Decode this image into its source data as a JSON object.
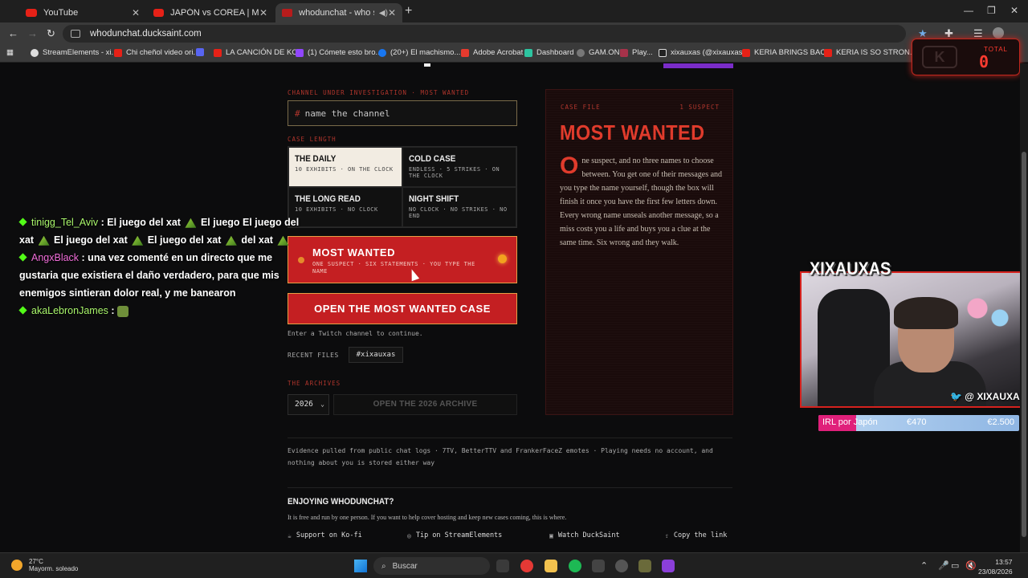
{
  "browser": {
    "tabs": [
      {
        "title": "YouTube"
      },
      {
        "title": "JAPÓN vs COREA | Mikkita y Bl..."
      },
      {
        "title": "whodunchat - who said it i"
      }
    ],
    "url": "whodunchat.ducksaint.com",
    "bookmarks": [
      "StreamElements - xi...",
      "Chi cheñol video ori...",
      "",
      "LA CANCIÓN DE KO...",
      "(1) Cómete esto bro...",
      "(20+) El machismo...",
      "Adobe Acrobat",
      "Dashboard",
      "GAM.ONL",
      "Play...",
      "xixauxas (@xixauxas...",
      "KERIA BRINGS BAC...",
      "KERIA IS SO STRON..."
    ]
  },
  "overlay_total": {
    "label": "TOTAL",
    "value": "0"
  },
  "form": {
    "channel_label": "CHANNEL UNDER INVESTIGATION · MOST WANTED",
    "channel_hash": "#",
    "channel_placeholder": "name the channel",
    "case_length_label": "CASE LENGTH",
    "modes": [
      {
        "name": "THE DAILY",
        "desc": "10 EXHIBITS · ON THE CLOCK",
        "selected": true
      },
      {
        "name": "COLD CASE",
        "desc": "ENDLESS · 5 STRIKES · ON THE CLOCK",
        "selected": false
      },
      {
        "name": "THE LONG READ",
        "desc": "10 EXHIBITS · NO CLOCK",
        "selected": false
      },
      {
        "name": "NIGHT SHIFT",
        "desc": "NO CLOCK · NO STRIKES · NO END",
        "selected": false
      }
    ],
    "most_wanted_title": "MOST WANTED",
    "most_wanted_desc": "ONE SUSPECT · SIX STATEMENTS · YOU TYPE THE NAME",
    "open_button": "OPEN THE MOST WANTED CASE",
    "hint": "Enter a Twitch channel to continue.",
    "recent_label": "RECENT FILES",
    "recent_chip": "#xixauxas",
    "archives_label": "THE ARCHIVES",
    "year": "2026",
    "archive_button": "OPEN THE 2026 ARCHIVE",
    "evidence": "Evidence pulled from public chat logs · 7TV, BetterTTV and FrankerFaceZ emotes · Playing needs no account, and nothing about you is stored either way",
    "enjoy_title": "ENJOYING WHODUNCHAT?",
    "enjoy_sub": "It is free and run by one person. If you want to help cover hosting and keep new cases coming, this is where.",
    "links": [
      "Support on Ko-fi",
      "Tip on StreamElements",
      "Watch DuckSaint",
      "Copy the link"
    ]
  },
  "case_file": {
    "label": "CASE FILE",
    "suspects": "1 SUSPECT",
    "title": "MOST WANTED",
    "dropcap": "O",
    "body": "ne suspect, and no three names to choose between. You get one of their messages and you type the name yourself, though the box will finish it once you have the first few letters down. Every wrong name unseals another message, so a miss costs you a life and buys you a clue at the same time. Six wrong and they walk."
  },
  "chat": [
    {
      "user": "tinigg_Tel_Aviv",
      "msg1": ": El juego del xat",
      "msg2": "El juego El juego del",
      "msg3": "xat",
      "msg4": "El juego del xat",
      "msg5": "El juego del xat",
      "msg6": "del xat"
    },
    {
      "user": "AngxBlack",
      "msg": ": una vez comenté en un directo que me gustaria que existiera el daño verdadero, para que mis enemigos sintieran dolor real, y me banearon"
    },
    {
      "user": "akaLebronJames",
      "msg": ":"
    }
  ],
  "webcam": {
    "name": "XIXAUXAS",
    "handle": "@ XIXAUXAS",
    "goal_label": "IRL por Japón",
    "goal_current": "€470",
    "goal_target": "€2.500",
    "goal_fraction": 0.188
  },
  "taskbar": {
    "temp": "27°C",
    "weather": "Mayorm. soleado",
    "search": "Buscar",
    "time": "13:57",
    "date": "23/08/2026"
  }
}
